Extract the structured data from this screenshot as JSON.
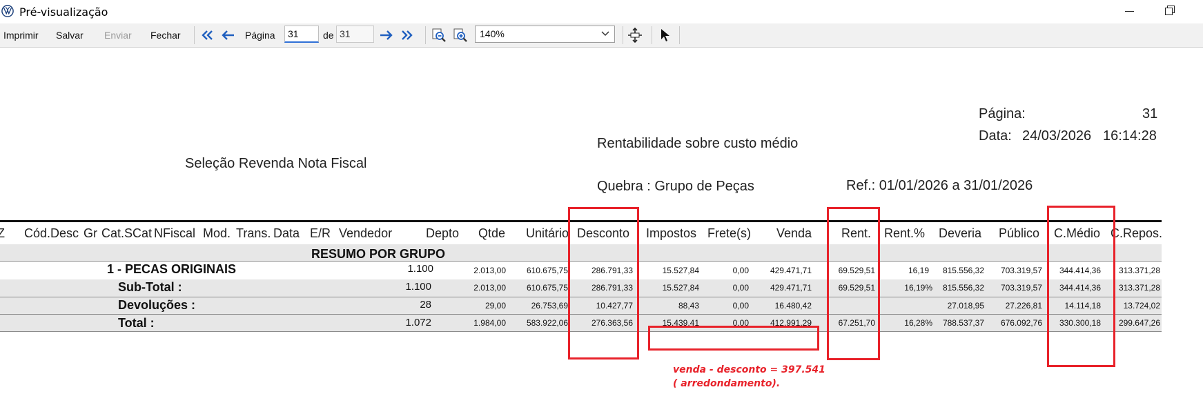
{
  "window": {
    "title": "Pré-visualização",
    "controls": [
      "minimize",
      "maximize"
    ]
  },
  "toolbar": {
    "print_label": "Imprimir",
    "save_label": "Salvar",
    "send_label": "Enviar",
    "close_label": "Fechar",
    "page_label": "Página",
    "page_value": "31",
    "of_label": "de",
    "page_total": "31",
    "zoom_value": "140%"
  },
  "report": {
    "page_label": "Página:",
    "page_number": "31",
    "date_label": "Data:",
    "date_value": "24/03/2026",
    "time_value": "16:14:28",
    "subtitle": "Rentabilidade sobre custo médio",
    "selection": "Seleção Revenda Nota Fiscal",
    "break_label": "Quebra : Grupo de Peças",
    "ref_label": "Ref.: 01/01/2026 a 31/01/2026",
    "columns": {
      "c0": "Z",
      "c1": "Cód.Desc",
      "c2": "Gr",
      "c3": "Cat.SCat",
      "c4": "NFiscal",
      "c5": "Mod.",
      "c6": "Trans.",
      "c7": "Data",
      "c8": "E/R",
      "c9": "Vendedor",
      "c10": "Depto",
      "c11": "Qtde",
      "c12": "Unitário",
      "c13": "Desconto",
      "c14": "Impostos",
      "c15": "Frete(s)",
      "c16": "Venda",
      "c17": "Rent.",
      "c18": "Rent.%",
      "c19": "Deveria",
      "c20": "Público",
      "c21": "C.Médio",
      "c22": "C.Repos."
    },
    "summary_title": "RESUMO POR GRUPO",
    "rows": [
      {
        "label": "1 - PECAS ORIGINAIS",
        "depto": "1.100",
        "qtde": "2.013,00",
        "unitario": "610.675,75",
        "desconto": "286.791,33",
        "impostos": "15.527,84",
        "fretes": "0,00",
        "venda": "429.471,71",
        "rent": "69.529,51",
        "rentp": "16,19",
        "deveria": "815.556,32",
        "publico": "703.319,57",
        "cmedio": "344.414,36",
        "crepos": "313.371,28"
      },
      {
        "label": "Sub-Total :",
        "depto": "1.100",
        "qtde": "2.013,00",
        "unitario": "610.675,75",
        "desconto": "286.791,33",
        "impostos": "15.527,84",
        "fretes": "0,00",
        "venda": "429.471,71",
        "rent": "69.529,51",
        "rentp": "16,19%",
        "deveria": "815.556,32",
        "publico": "703.319,57",
        "cmedio": "344.414,36",
        "crepos": "313.371,28"
      },
      {
        "label": "Devoluções :",
        "depto": "28",
        "qtde": "29,00",
        "unitario": "26.753,69",
        "desconto": "10.427,77",
        "impostos": "88,43",
        "fretes": "0,00",
        "venda": "16.480,42",
        "rent": "",
        "rentp": "",
        "deveria": "27.018,95",
        "publico": "27.226,81",
        "cmedio": "14.114,18",
        "crepos": "13.724,02"
      },
      {
        "label": "Total :",
        "depto": "1.072",
        "qtde": "1.984,00",
        "unitario": "583.922,06",
        "desconto": "276.363,56",
        "impostos": "15.439,41",
        "fretes": "0,00",
        "venda": "412.991,29",
        "rent": "67.251,70",
        "rentp": "16,28%",
        "deveria": "788.537,37",
        "publico": "676.092,76",
        "cmedio": "330.300,18",
        "crepos": "299.647,26"
      }
    ]
  },
  "annotation": {
    "line1": "venda - desconto = 397.541",
    "line2": "( arredondamento).",
    "color": "#e8222a"
  },
  "colors": {
    "accent": "#2f6fd6",
    "highlight": "#e8222a",
    "band": "#e7e7e7"
  }
}
